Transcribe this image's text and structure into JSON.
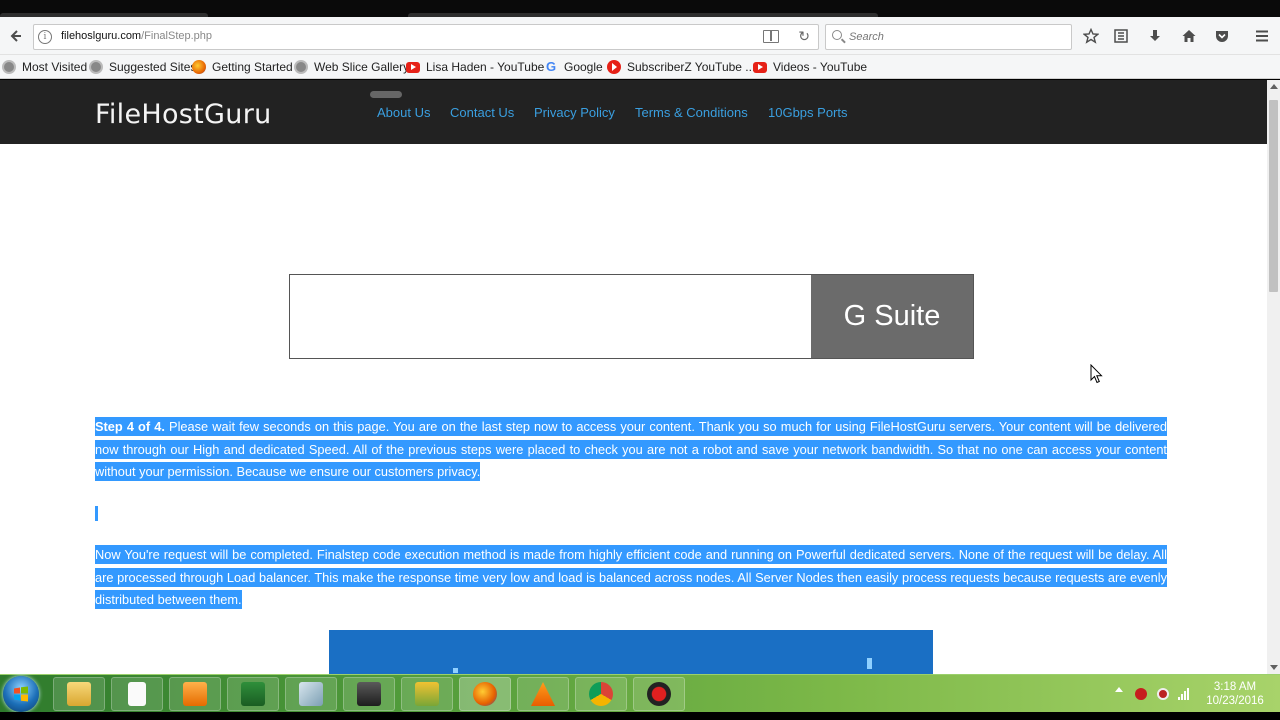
{
  "browser": {
    "url_domain": "filehoslguru.com",
    "url_path": "/FinalStep.php",
    "search_placeholder": "Search"
  },
  "bookmarks": [
    {
      "label": "Most Visited",
      "icon": "globe-icon"
    },
    {
      "label": "Suggested Sites",
      "icon": "globe-icon"
    },
    {
      "label": "Getting Started",
      "icon": "firefox-icon"
    },
    {
      "label": "Web Slice Gallery",
      "icon": "globe-icon"
    },
    {
      "label": "Lisa Haden - YouTube",
      "icon": "youtube-icon"
    },
    {
      "label": "Google",
      "icon": "google-icon"
    },
    {
      "label": "SubscriberZ YouTube ...",
      "icon": "subscriberz-icon"
    },
    {
      "label": "Videos - YouTube",
      "icon": "youtube-icon"
    }
  ],
  "site": {
    "logo": "FileHostGuru",
    "nav": [
      "About Us",
      "Contact Us",
      "Privacy Policy",
      "Terms & Conditions",
      "10Gbps Ports"
    ]
  },
  "ad": {
    "brand": "G Suite"
  },
  "content": {
    "step_label": "Step 4 of 4.",
    "para1_rest": " Please wait few seconds on this page. You are on the last step now to access your content. Thank you so much for using FileHostGuru servers. Your content will be delivered now through our High and dedicated Speed. All of the previous steps were placed to check you are not a robot and save your network bandwidth. So that no one can access your content without your permission. Because we ensure our customers privacy.",
    "para2": "Now You're request will be completed. Finalstep code execution method is made from highly efficient code and running on Powerful dedicated servers. None of the request will be delay. All are processed through Load balancer. This make the response time very low and load is balanced across nodes. All Server Nodes then easily process requests because requests are evenly distributed between them."
  },
  "taskbar": {
    "time": "3:18 AM",
    "date": "10/23/2016",
    "apps": [
      "explorer-icon",
      "notepad-icon",
      "media-player-icon",
      "spreadsheet-icon",
      "tool-icon",
      "video-editor-icon",
      "archive-icon",
      "firefox-icon",
      "vlc-icon",
      "chrome-icon",
      "recorder-icon"
    ]
  },
  "colors": {
    "selection": "#3399ff",
    "link": "#3a9fe0",
    "header_bg": "#222222",
    "taskbar": "#5fa83e"
  }
}
